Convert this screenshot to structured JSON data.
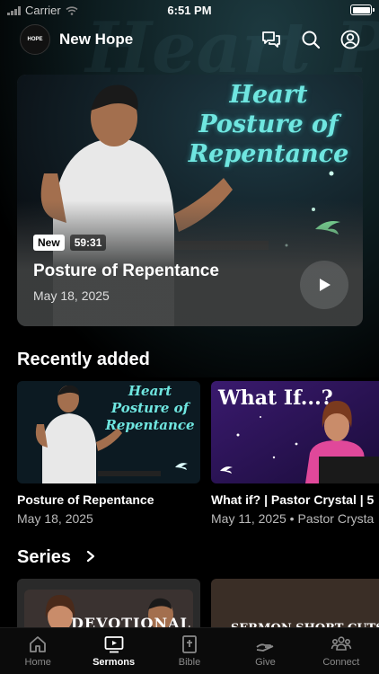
{
  "status_bar": {
    "carrier": "Carrier",
    "time": "6:51 PM"
  },
  "header": {
    "logo_text": "HOPE",
    "title": "New Hope"
  },
  "hero": {
    "artwork_title": "Heart Posture of Repentance",
    "badge": "New",
    "duration": "59:31",
    "title": "Posture of Repentance",
    "date": "May 18, 2025"
  },
  "recently_added": {
    "heading": "Recently added",
    "items": [
      {
        "artwork_title": "Heart Posture of Repentance",
        "title": "Posture of Repentance",
        "subtitle": "May 18, 2025"
      },
      {
        "artwork_title": "What If...?",
        "title": "What if? | Pastor Crystal | 5",
        "subtitle": "May 11, 2025 • Pastor Crysta"
      }
    ]
  },
  "series": {
    "heading": "Series",
    "items": [
      {
        "artwork_title": "DEVOTIONAL"
      },
      {
        "artwork_title": "SERMON SHORT CUTS"
      }
    ]
  },
  "tabbar": {
    "tabs": [
      {
        "label": "Home",
        "icon": "home-icon"
      },
      {
        "label": "Sermons",
        "icon": "sermons-icon"
      },
      {
        "label": "Bible",
        "icon": "bible-icon"
      },
      {
        "label": "Give",
        "icon": "give-icon"
      },
      {
        "label": "Connect",
        "icon": "connect-icon"
      }
    ],
    "active": "Sermons"
  },
  "colors": {
    "accent_teal": "#6fe6e0",
    "background": "#000000",
    "inactive_tab": "#8a8a8a"
  }
}
